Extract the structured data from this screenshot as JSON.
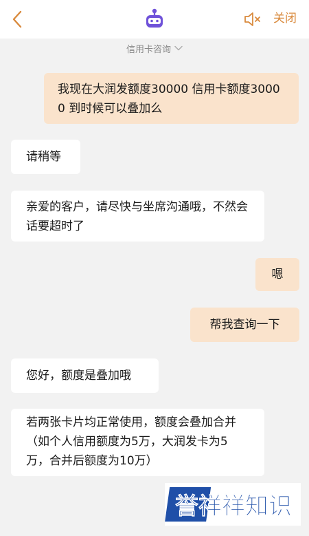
{
  "header": {
    "back_icon": "chevron-left-icon",
    "avatar_icon": "robot-avatar-icon",
    "mute_icon": "speaker-mute-icon",
    "close_label": "关闭",
    "accent_color": "#d98a3d"
  },
  "topic": {
    "label": "信用卡咨询",
    "icon": "chevron-down-icon"
  },
  "messages": [
    {
      "from": "user",
      "text": "我现在大润发额度30000 信用卡额度30000 到时候可以叠加么"
    },
    {
      "from": "bot",
      "text": "请稍等"
    },
    {
      "from": "bot",
      "text": "亲爱的客户，请尽快与坐席沟通哦，不然会话要超时了"
    },
    {
      "from": "user",
      "text": "嗯"
    },
    {
      "from": "user",
      "text": "帮我查询一下"
    },
    {
      "from": "bot",
      "text": "您好，额度是叠加哦"
    },
    {
      "from": "bot",
      "text": "若两张卡片均正常使用，额度会叠加合并（如个人信用额度为5万，大润发卡为5万，合并后额度为10万）"
    }
  ],
  "watermark": {
    "text": "誉祥祥知识",
    "color": "#1f4fa8"
  },
  "colors": {
    "user_bubble": "#fae3cc",
    "bot_bubble": "#ffffff",
    "background": "#f2f2f2"
  }
}
